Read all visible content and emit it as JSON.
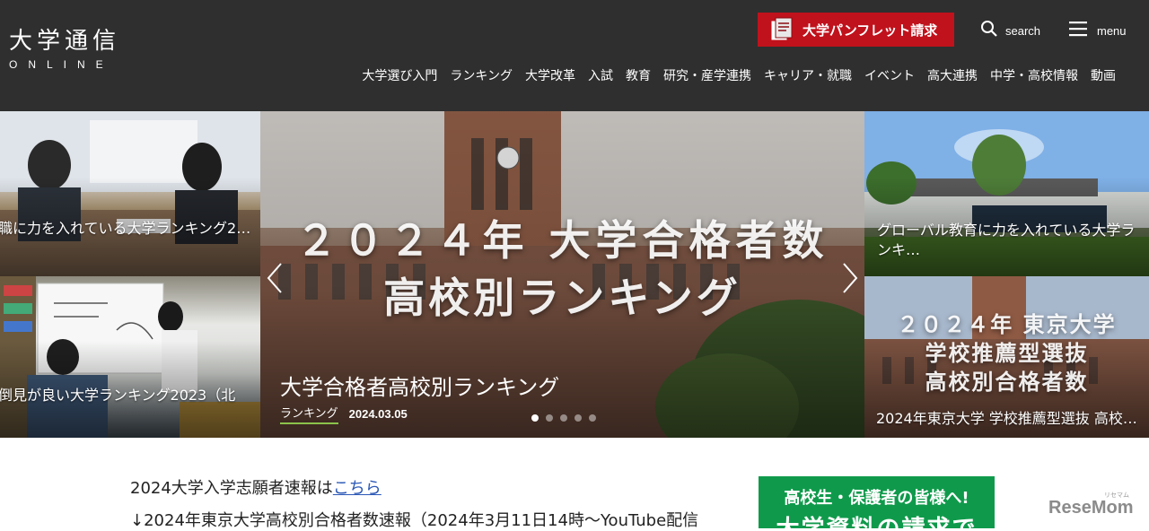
{
  "header": {
    "logo_main": "大学通信",
    "logo_sub": "ONLINE",
    "pamphlet_label": "大学パンフレット請求",
    "search_label": "search",
    "menu_label": "menu",
    "colors": {
      "header_bg": "#2f2f2f",
      "pamphlet_bg": "#c0121c"
    },
    "nav": [
      "大学選び入門",
      "ランキング",
      "大学改革",
      "入試",
      "教育",
      "研究・産学連携",
      "キャリア・就職",
      "イベント",
      "高大連携",
      "中学・高校情報",
      "動画"
    ]
  },
  "hero": {
    "tiles": {
      "top_left": "職に力を入れている大学ランキング2…",
      "bottom_left": "倒見が良い大学ランキング2023（北",
      "top_right": "グローバル教育に力を入れている大学ランキ…",
      "bottom_right": "2024年東京大学 学校推薦型選抜 高校…",
      "bottom_right_overlay": [
        "２０２４年 東京大学",
        "学校推薦型選抜",
        "高校別合格者数"
      ]
    },
    "main": {
      "overlay_line1": "２０２４年 大学合格者数",
      "overlay_line2": "高校別ランキング",
      "title": "大学合格者高校別ランキング",
      "category": "ランキング",
      "date": "2024.03.05",
      "arrow_left": "‹",
      "arrow_right": "›",
      "slide_count": 5,
      "active_slide": 0
    }
  },
  "content": {
    "notice1_prefix": "2024大学入学志願者速報は",
    "notice1_link": "こちら",
    "notice2": "↓2024年東京大学高校別合格者数速報（2024年3月11日14時〜YouTube配信"
  },
  "promo": {
    "line1": "高校生・保護者の皆様へ!",
    "line2": "大学資料の請求で",
    "bg": "#0f9a4b"
  },
  "watermark": {
    "brand": "ReseMom",
    "ruby": "リセマム"
  }
}
